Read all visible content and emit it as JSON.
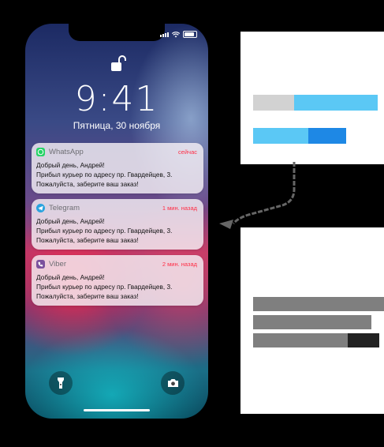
{
  "status_bar": {
    "signal": "signal-icon",
    "wifi": "wifi-icon",
    "battery": "battery-icon"
  },
  "lock_screen": {
    "lock_icon": "unlocked-padlock-icon",
    "time": "9:41",
    "date": "Пятница, 30 ноября",
    "flashlight_icon": "flashlight-icon",
    "camera_icon": "camera-icon"
  },
  "notifications": [
    {
      "app": "WhatsApp",
      "icon": "whatsapp-icon",
      "icon_color": "#25D366",
      "time": "сейчас",
      "lines": [
        "Добрый день, Андрей!",
        "Прибыл курьер по адресу пр. Гвардейцев, 3.",
        "Пожалуйста, заберите ваш заказ!"
      ]
    },
    {
      "app": "Telegram",
      "icon": "telegram-icon",
      "icon_color": "#2AA3DE",
      "time": "1 мин. назад",
      "lines": [
        "Добрый день, Андрей!",
        "Прибыл курьер по адресу пр. Гвардейцев, 3.",
        "Пожалуйста, заберите ваш заказ!"
      ]
    },
    {
      "app": "Viber",
      "icon": "viber-icon",
      "icon_color": "#7B519D",
      "time": "2 мин. назад",
      "lines": [
        "Добрый день, Андрей!",
        "Прибыл курьер по адресу пр. Гвардейцев, 3.",
        "Пожалуйста, заберите ваш заказ!"
      ]
    }
  ],
  "colors": {
    "accent_light_blue": "#5BC8F5",
    "accent_blue": "#1E88E5",
    "placeholder_gray": "#7f7f7f",
    "placeholder_dark": "#4a4a4a"
  }
}
